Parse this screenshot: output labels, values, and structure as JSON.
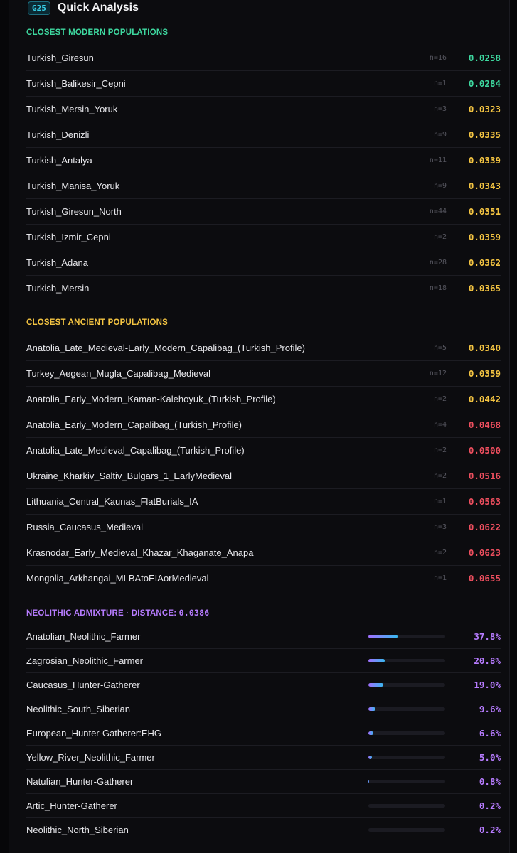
{
  "header": {
    "badge": "G25",
    "title": "Quick Analysis"
  },
  "colors": {
    "green": "#3ed9a0",
    "yellow": "#f5c542",
    "red": "#ef4f5f",
    "purple": "#b77cff",
    "section_modern": "#3ed9a0",
    "section_ancient": "#f5c542",
    "section_admixture": "#b77cff"
  },
  "modern": {
    "title": "CLOSEST MODERN POPULATIONS",
    "rows": [
      {
        "name": "Turkish_Giresun",
        "n": "n=16",
        "value": "0.0258",
        "color": "green"
      },
      {
        "name": "Turkish_Balikesir_Cepni",
        "n": "n=1",
        "value": "0.0284",
        "color": "green"
      },
      {
        "name": "Turkish_Mersin_Yoruk",
        "n": "n=3",
        "value": "0.0323",
        "color": "yellow"
      },
      {
        "name": "Turkish_Denizli",
        "n": "n=9",
        "value": "0.0335",
        "color": "yellow"
      },
      {
        "name": "Turkish_Antalya",
        "n": "n=11",
        "value": "0.0339",
        "color": "yellow"
      },
      {
        "name": "Turkish_Manisa_Yoruk",
        "n": "n=9",
        "value": "0.0343",
        "color": "yellow"
      },
      {
        "name": "Turkish_Giresun_North",
        "n": "n=44",
        "value": "0.0351",
        "color": "yellow"
      },
      {
        "name": "Turkish_Izmir_Cepni",
        "n": "n=2",
        "value": "0.0359",
        "color": "yellow"
      },
      {
        "name": "Turkish_Adana",
        "n": "n=28",
        "value": "0.0362",
        "color": "yellow"
      },
      {
        "name": "Turkish_Mersin",
        "n": "n=18",
        "value": "0.0365",
        "color": "yellow"
      }
    ]
  },
  "ancient": {
    "title": "CLOSEST ANCIENT POPULATIONS",
    "rows": [
      {
        "name": "Anatolia_Late_Medieval-Early_Modern_Capalibag_(Turkish_Profile)",
        "n": "n=5",
        "value": "0.0340",
        "color": "yellow"
      },
      {
        "name": "Turkey_Aegean_Mugla_Capalibag_Medieval",
        "n": "n=12",
        "value": "0.0359",
        "color": "yellow"
      },
      {
        "name": "Anatolia_Early_Modern_Kaman-Kalehoyuk_(Turkish_Profile)",
        "n": "n=2",
        "value": "0.0442",
        "color": "yellow"
      },
      {
        "name": "Anatolia_Early_Modern_Capalibag_(Turkish_Profile)",
        "n": "n=4",
        "value": "0.0468",
        "color": "red"
      },
      {
        "name": "Anatolia_Late_Medieval_Capalibag_(Turkish_Profile)",
        "n": "n=2",
        "value": "0.0500",
        "color": "red"
      },
      {
        "name": "Ukraine_Kharkiv_Saltiv_Bulgars_1_EarlyMedieval",
        "n": "n=2",
        "value": "0.0516",
        "color": "red"
      },
      {
        "name": "Lithuania_Central_Kaunas_FlatBurials_IA",
        "n": "n=1",
        "value": "0.0563",
        "color": "red"
      },
      {
        "name": "Russia_Caucasus_Medieval",
        "n": "n=3",
        "value": "0.0622",
        "color": "red"
      },
      {
        "name": "Krasnodar_Early_Medieval_Khazar_Khaganate_Anapa",
        "n": "n=2",
        "value": "0.0623",
        "color": "red"
      },
      {
        "name": "Mongolia_Arkhangai_MLBAtoEIAorMedieval",
        "n": "n=1",
        "value": "0.0655",
        "color": "red"
      }
    ]
  },
  "admixture": {
    "title_prefix": "NEOLITHIC ADMIXTURE · DISTANCE: ",
    "distance": "0.0386",
    "rows": [
      {
        "name": "Anatolian_Neolithic_Farmer",
        "pct": "37.8%",
        "fraction": 0.378
      },
      {
        "name": "Zagrosian_Neolithic_Farmer",
        "pct": "20.8%",
        "fraction": 0.208
      },
      {
        "name": "Caucasus_Hunter-Gatherer",
        "pct": "19.0%",
        "fraction": 0.19
      },
      {
        "name": "Neolithic_South_Siberian",
        "pct": "9.6%",
        "fraction": 0.096
      },
      {
        "name": "European_Hunter-Gatherer:EHG",
        "pct": "6.6%",
        "fraction": 0.066
      },
      {
        "name": "Yellow_River_Neolithic_Farmer",
        "pct": "5.0%",
        "fraction": 0.05
      },
      {
        "name": "Natufian_Hunter-Gatherer",
        "pct": "0.8%",
        "fraction": 0.008
      },
      {
        "name": "Artic_Hunter-Gatherer",
        "pct": "0.2%",
        "fraction": 0.002
      },
      {
        "name": "Neolithic_North_Siberian",
        "pct": "0.2%",
        "fraction": 0.002
      }
    ]
  }
}
